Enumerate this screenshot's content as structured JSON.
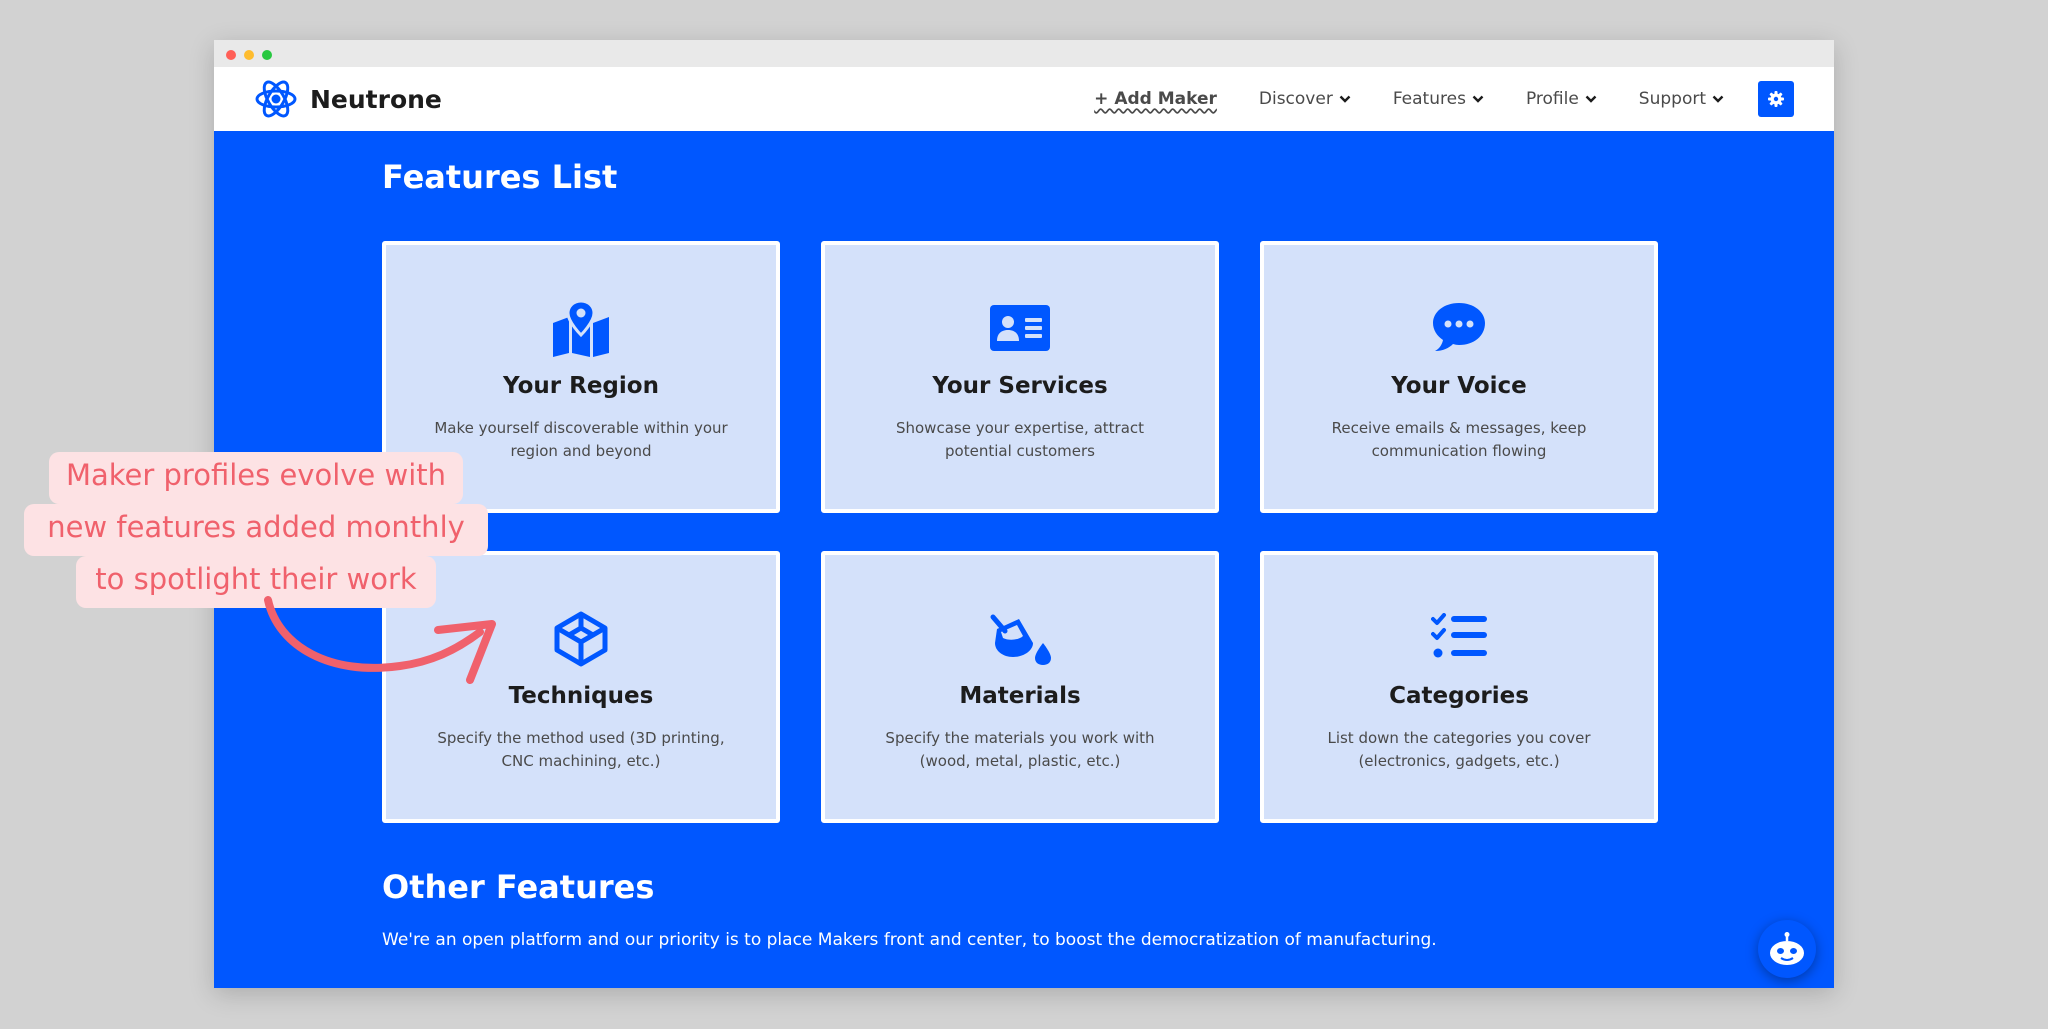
{
  "brand": {
    "name": "Neutrone"
  },
  "nav": {
    "add_maker": "+ Add Maker",
    "discover": "Discover",
    "features": "Features",
    "profile": "Profile",
    "support": "Support"
  },
  "features_list": {
    "title": "Features List",
    "cards": [
      {
        "icon": "map-pin-icon",
        "title": "Your Region",
        "desc": "Make yourself discoverable within your region and beyond"
      },
      {
        "icon": "id-card-icon",
        "title": "Your Services",
        "desc": "Showcase your expertise, attract potential customers"
      },
      {
        "icon": "chat-bubble-icon",
        "title": "Your Voice",
        "desc": "Receive emails & messages, keep communication flowing"
      },
      {
        "icon": "cube-icon",
        "title": "Techniques",
        "desc": "Specify the method used (3D printing, CNC machining, etc.)"
      },
      {
        "icon": "paint-bucket-icon",
        "title": "Materials",
        "desc": "Specify the materials you work with (wood, metal, plastic, etc.)"
      },
      {
        "icon": "checklist-icon",
        "title": "Categories",
        "desc": "List down the categories you cover (electronics, gadgets, etc.)"
      }
    ]
  },
  "other_features": {
    "title": "Other Features",
    "text": "We're an open platform and our priority is to place Makers front and center, to boost the democratization of manufacturing."
  },
  "annotation": {
    "lines": [
      "Maker profiles evolve with",
      "new features added monthly",
      "to spotlight their work"
    ],
    "color": "#f0616c"
  },
  "colors": {
    "brand_blue": "#0057ff",
    "card_bg": "#d4e1fa"
  }
}
